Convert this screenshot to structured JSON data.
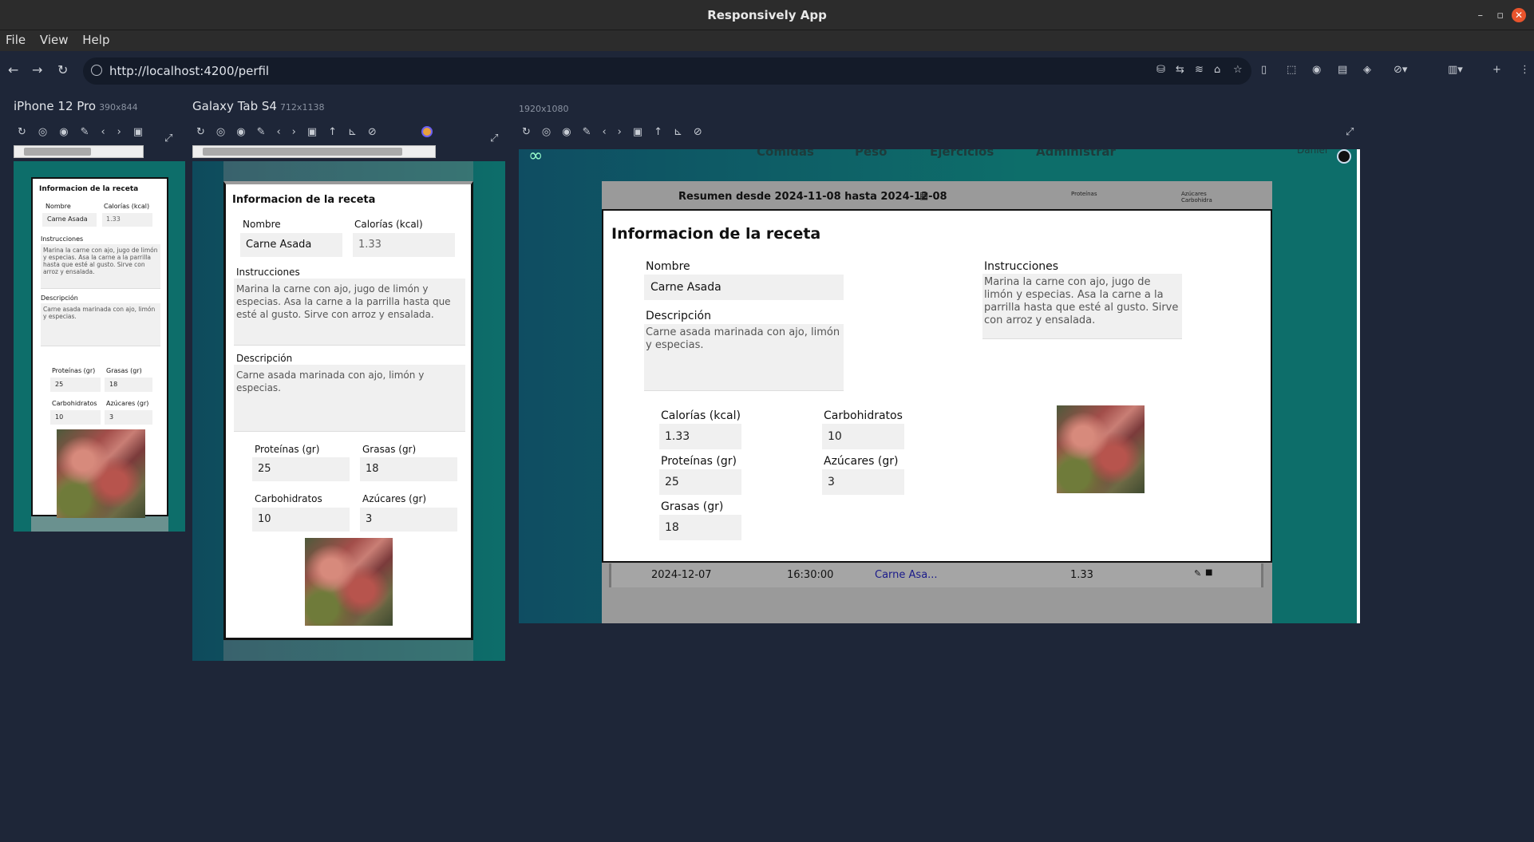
{
  "app": {
    "title": "Responsively App"
  },
  "window_controls": {
    "minimize": "–",
    "maximize": "▫",
    "close": "✕"
  },
  "menu": [
    "File",
    "View",
    "Help"
  ],
  "address": {
    "url": "http://localhost:4200/perfil"
  },
  "devices": [
    {
      "name": "iPhone 12 Pro",
      "size": "390x844"
    },
    {
      "name": "Galaxy Tab S4",
      "size": "712x1138"
    },
    {
      "name": "",
      "size": "1920x1080"
    }
  ],
  "recipe": {
    "title": "Informacion de la receta",
    "nombre_label": "Nombre",
    "nombre_value": "Carne Asada",
    "calorias_label": "Calorías (kcal)",
    "calorias_value": "1.33",
    "instrucciones_label": "Instrucciones",
    "instrucciones_value": "Marina la carne con ajo, jugo de limón y especias. Asa la carne a la parrilla hasta que esté al gusto. Sirve con arroz y ensalada.",
    "descripcion_label": "Descripción",
    "descripcion_value": "Carne asada marinada con ajo, limón y especias.",
    "proteinas_label": "Proteínas (gr)",
    "proteinas_value": "25",
    "grasas_label": "Grasas (gr)",
    "grasas_value": "18",
    "carbohidratos_label": "Carbohidratos",
    "carbohidratos_value": "10",
    "azucares_label": "Azúcares (gr)",
    "azucares_value": "3"
  },
  "desktop_bg": {
    "nav": [
      "Comidas",
      "Peso",
      "Ejercicios",
      "Administrar"
    ],
    "user": "Daniel",
    "resumen": "Resumen desde 2024-11-08 hasta 2024-12-08",
    "chart_labels": [
      "Proteínas",
      "Azúcares",
      "Carbohidra"
    ],
    "row": {
      "date": "2024-12-07",
      "time": "16:30:00",
      "food": "Carne Asa...",
      "cal": "1.33"
    }
  }
}
